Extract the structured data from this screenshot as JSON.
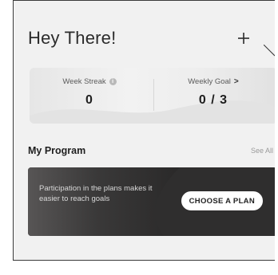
{
  "header": {
    "greeting": "Hey There!",
    "add_icon": "plus-icon"
  },
  "stats": {
    "week_streak": {
      "label": "Week Streak",
      "value": "0",
      "icon": "info-icon"
    },
    "weekly_goal": {
      "label": "Weekly Goal",
      "chevron": ">",
      "value": "0 / 3"
    }
  },
  "program": {
    "section_title": "My Program",
    "see_all": "See All",
    "card_text": "Participation in the plans makes it easier to reach goals",
    "cta_label": "CHOOSE A PLAN"
  },
  "colors": {
    "screen_bg": "#f1f1f1",
    "card_dark": "#2f2e2e",
    "button_bg": "#ffffff"
  }
}
